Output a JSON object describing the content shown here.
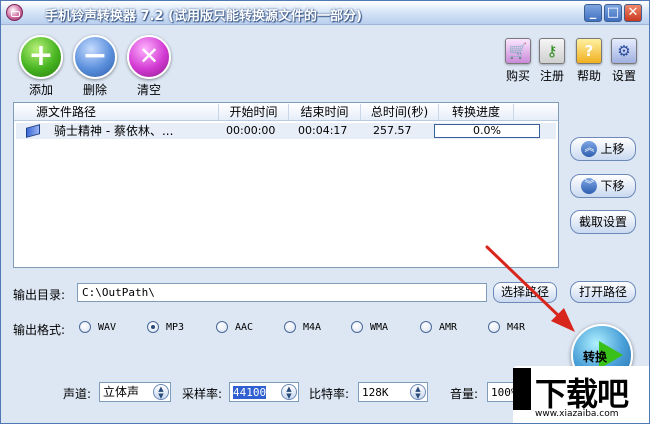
{
  "window": {
    "title": "手机铃声转换器 7.2 (试用版只能转换源文件的一部分)",
    "controls": {
      "minimize": "_",
      "maximize": "□",
      "close": "✕"
    }
  },
  "toolbar": {
    "add_label": "添加",
    "delete_label": "删除",
    "clear_label": "清空",
    "add_glyph": "+",
    "delete_glyph": "−",
    "clear_glyph": "✕"
  },
  "top_right": {
    "buy_label": "购买",
    "register_label": "注册",
    "help_label": "帮助",
    "settings_label": "设置",
    "buy_icon": "cart-icon",
    "register_icon": "key-icon",
    "help_icon": "help-icon",
    "settings_icon": "tools-icon"
  },
  "file_list": {
    "columns": [
      "源文件路径",
      "开始时间",
      "结束时间",
      "总时间(秒)",
      "转换进度"
    ],
    "rows": [
      {
        "path": "骑士精神 - 蔡依林、...",
        "start": "00:00:00",
        "end": "00:04:17",
        "total": "257.57",
        "progress": "0.0%",
        "progress_value": 0
      }
    ]
  },
  "side_buttons": {
    "up": "上移",
    "down": "下移",
    "trim_settings": "截取设置",
    "open_path": "打开路径",
    "up_glyph": "︽",
    "down_glyph": "︾"
  },
  "output": {
    "dir_label": "输出目录:",
    "dir_value": "C:\\OutPath\\",
    "choose_path": "选择路径",
    "format_label": "输出格式:",
    "formats": [
      "WAV",
      "MP3",
      "AAC",
      "M4A",
      "WMA",
      "AMR",
      "M4R"
    ],
    "selected_format": "MP3"
  },
  "convert": {
    "label": "转换"
  },
  "bottom": {
    "channel_label": "声道:",
    "channel_value": "立体声",
    "samplerate_label": "采样率:",
    "samplerate_value": "44100",
    "bitrate_label": "比特率:",
    "bitrate_value": "128K",
    "volume_label": "音量:",
    "volume_value": "100%"
  },
  "watermark": {
    "main": "下载吧",
    "sub": "www.xiazaiba.com"
  },
  "colors": {
    "accent": "#4f79b5",
    "window_bg": "#dde7f4",
    "annotation_arrow": "#d9261c"
  }
}
